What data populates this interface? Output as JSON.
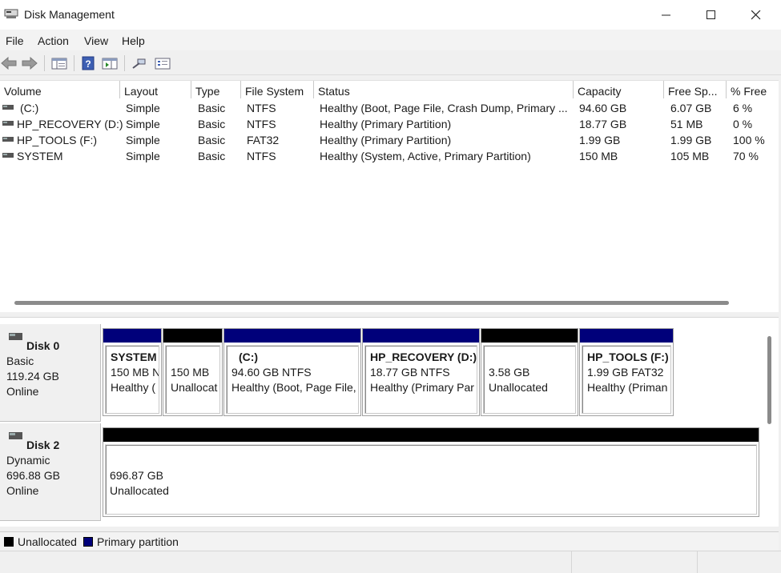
{
  "window": {
    "title": "Disk Management"
  },
  "menu": [
    "File",
    "Action",
    "View",
    "Help"
  ],
  "colors": {
    "primary": "#00007a",
    "unallocated": "#000000"
  },
  "volume_table": {
    "headers": [
      "Volume",
      "Layout",
      "Type",
      "File System",
      "Status",
      "Capacity",
      "Free Sp...",
      "% Free"
    ],
    "rows": [
      [
        "(C:)",
        "Simple",
        "Basic",
        "NTFS",
        "Healthy (Boot, Page File, Crash Dump, Primary ...",
        "94.60 GB",
        "6.07 GB",
        "6 %"
      ],
      [
        "HP_RECOVERY (D:)",
        "Simple",
        "Basic",
        "NTFS",
        "Healthy (Primary Partition)",
        "18.77 GB",
        "51 MB",
        "0 %"
      ],
      [
        "HP_TOOLS (F:)",
        "Simple",
        "Basic",
        "FAT32",
        "Healthy (Primary Partition)",
        "1.99 GB",
        "1.99 GB",
        "100 %"
      ],
      [
        "SYSTEM",
        "Simple",
        "Basic",
        "NTFS",
        "Healthy (System, Active, Primary Partition)",
        "150 MB",
        "105 MB",
        "70 %"
      ]
    ]
  },
  "disks": [
    {
      "name": "Disk 0",
      "type": "Basic",
      "size": "119.24 GB",
      "state": "Online",
      "partitions": [
        {
          "kind": "primary",
          "l1": "SYSTEM",
          "l2": "150 MB N",
          "l3": "Healthy ("
        },
        {
          "kind": "unallocated",
          "l1": "",
          "l2": "150 MB",
          "l3": "Unallocat"
        },
        {
          "kind": "primary",
          "l1": "(C:)",
          "l2": "94.60 GB NTFS",
          "l3": "Healthy (Boot, Page File,"
        },
        {
          "kind": "primary",
          "l1": "HP_RECOVERY  (D:)",
          "l2": "18.77 GB NTFS",
          "l3": "Healthy (Primary Par"
        },
        {
          "kind": "unallocated",
          "l1": "",
          "l2": "3.58 GB",
          "l3": "Unallocated"
        },
        {
          "kind": "primary",
          "l1": "HP_TOOLS  (F:)",
          "l2": "1.99 GB FAT32",
          "l3": "Healthy (Priman"
        }
      ]
    },
    {
      "name": "Disk 2",
      "type": "Dynamic",
      "size": "696.88 GB",
      "state": "Online",
      "partitions": [
        {
          "kind": "unallocated",
          "l1": "",
          "l2": "696.87 GB",
          "l3": "Unallocated"
        }
      ]
    }
  ],
  "legend": [
    "Unallocated",
    "Primary partition"
  ]
}
